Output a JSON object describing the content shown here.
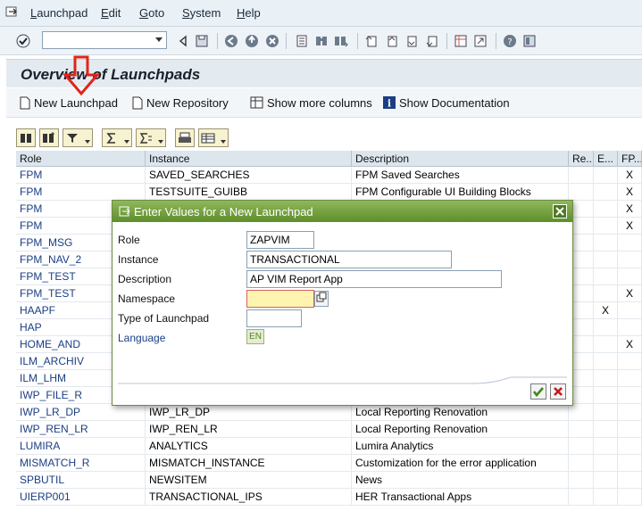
{
  "menu": {
    "items": [
      "Launchpad",
      "Edit",
      "Goto",
      "System",
      "Help"
    ]
  },
  "toolbar": {
    "command_field_value": "",
    "icons": [
      "enter-icon",
      "back-icon",
      "save-icon",
      "back-arrow-icon",
      "exit-icon",
      "cancel-icon",
      "print-icon",
      "find-icon",
      "find-next-icon",
      "first-page-icon",
      "previous-page-icon",
      "next-page-icon",
      "last-page-icon",
      "new-session-icon",
      "shortcut-icon",
      "help-icon",
      "layout-icon"
    ]
  },
  "page": {
    "title": "Overview of Launchpads"
  },
  "app_toolbar": {
    "new_launchpad": "New Launchpad",
    "new_repository": "New Repository",
    "show_more_columns": "Show more columns",
    "show_documentation": "Show Documentation"
  },
  "grid": {
    "columns": [
      "Role",
      "Instance",
      "Description",
      "Re...",
      "E...",
      "FP..."
    ],
    "rows": [
      {
        "role": "FPM",
        "instance": "SAVED_SEARCHES",
        "description": "FPM Saved Searches",
        "re": "",
        "e": "",
        "fp": "X"
      },
      {
        "role": "FPM",
        "instance": "TESTSUITE_GUIBB",
        "description": "FPM Configurable UI Building Blocks",
        "re": "",
        "e": "",
        "fp": "X"
      },
      {
        "role": "FPM",
        "instance": "",
        "description": "",
        "re": "",
        "e": "",
        "fp": "X"
      },
      {
        "role": "FPM",
        "instance": "",
        "description": "",
        "re": "",
        "e": "",
        "fp": "X"
      },
      {
        "role": "FPM_MSG",
        "instance": "",
        "description": "",
        "re": "",
        "e": "",
        "fp": ""
      },
      {
        "role": "FPM_NAV_2",
        "instance": "",
        "description": "",
        "re": "",
        "e": "",
        "fp": ""
      },
      {
        "role": "FPM_TEST",
        "instance": "",
        "description": "",
        "re": "",
        "e": "",
        "fp": ""
      },
      {
        "role": "FPM_TEST",
        "instance": "",
        "description": "",
        "re": "",
        "e": "",
        "fp": "X"
      },
      {
        "role": "HAAPF",
        "instance": "",
        "description": "",
        "re": "",
        "e": "X",
        "fp": ""
      },
      {
        "role": "HAP",
        "instance": "",
        "description": "",
        "re": "",
        "e": "",
        "fp": ""
      },
      {
        "role": "HOME_AND",
        "instance": "",
        "description": "",
        "re": "",
        "e": "",
        "fp": "X"
      },
      {
        "role": "ILM_ARCHIV",
        "instance": "",
        "description": "",
        "re": "",
        "e": "",
        "fp": ""
      },
      {
        "role": "ILM_LHM",
        "instance": "",
        "description": "",
        "re": "",
        "e": "",
        "fp": ""
      },
      {
        "role": "IWP_FILE_R",
        "instance": "",
        "description": "",
        "re": "",
        "e": "",
        "fp": ""
      },
      {
        "role": "IWP_LR_DP",
        "instance": "IWP_LR_DP",
        "description": "Local Reporting Renovation",
        "re": "",
        "e": "",
        "fp": ""
      },
      {
        "role": "IWP_REN_LR",
        "instance": "IWP_REN_LR",
        "description": "Local Reporting Renovation",
        "re": "",
        "e": "",
        "fp": ""
      },
      {
        "role": "LUMIRA",
        "instance": "ANALYTICS",
        "description": "Lumira Analytics",
        "re": "",
        "e": "",
        "fp": ""
      },
      {
        "role": "MISMATCH_R",
        "instance": "MISMATCH_INSTANCE",
        "description": "Customization for the error application",
        "re": "",
        "e": "",
        "fp": ""
      },
      {
        "role": "SPBUTIL",
        "instance": "NEWSITEM",
        "description": "News",
        "re": "",
        "e": "",
        "fp": ""
      },
      {
        "role": "UIERP001",
        "instance": "TRANSACTIONAL_IPS",
        "description": "HER Transactional Apps",
        "re": "",
        "e": "",
        "fp": ""
      }
    ]
  },
  "dialog": {
    "title": "Enter Values for a New Launchpad",
    "fields": {
      "role_label": "Role",
      "role_value": "ZAPVIM",
      "instance_label": "Instance",
      "instance_value": "TRANSACTIONAL",
      "description_label": "Description",
      "description_value": "AP VIM Report App",
      "namespace_label": "Namespace",
      "namespace_value": "",
      "type_label": "Type of Launchpad",
      "type_value": "",
      "language_label": "Language",
      "language_value": "EN"
    }
  },
  "colors": {
    "dialog_title": "#6f9d3a",
    "annotation_arrow": "#e2231a",
    "role_link": "#1b3e85"
  }
}
